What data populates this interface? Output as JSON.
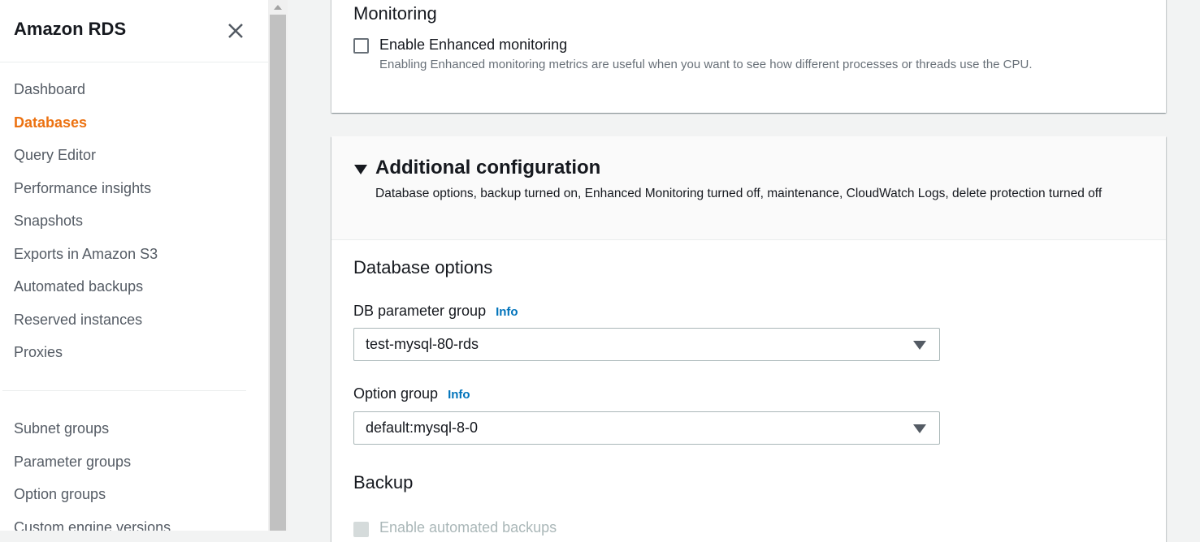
{
  "sidebar": {
    "title": "Amazon RDS",
    "primary_items": [
      {
        "label": "Dashboard"
      },
      {
        "label": "Databases",
        "active": true
      },
      {
        "label": "Query Editor"
      },
      {
        "label": "Performance insights"
      },
      {
        "label": "Snapshots"
      },
      {
        "label": "Exports in Amazon S3"
      },
      {
        "label": "Automated backups"
      },
      {
        "label": "Reserved instances"
      },
      {
        "label": "Proxies"
      }
    ],
    "secondary_items": [
      {
        "label": "Subnet groups"
      },
      {
        "label": "Parameter groups"
      },
      {
        "label": "Option groups"
      },
      {
        "label": "Custom engine versions"
      }
    ]
  },
  "monitoring": {
    "heading": "Monitoring",
    "enhanced_label": "Enable Enhanced monitoring",
    "enhanced_desc": "Enabling Enhanced monitoring metrics are useful when you want to see how different processes or threads use the CPU.",
    "enhanced_checked": false
  },
  "additional": {
    "title": "Additional configuration",
    "description": "Database options, backup turned on, Enhanced Monitoring turned off, maintenance, CloudWatch Logs, delete protection turned off",
    "database_options_heading": "Database options",
    "db_parameter_group_label": "DB parameter group",
    "db_parameter_group_value": "test-mysql-80-rds",
    "option_group_label": "Option group",
    "option_group_value": "default:mysql-8-0",
    "info_label": "Info",
    "backup_heading": "Backup",
    "automated_backups_label": "Enable automated backups"
  },
  "colors": {
    "accent": "#ec7211",
    "link": "#0073bb"
  }
}
